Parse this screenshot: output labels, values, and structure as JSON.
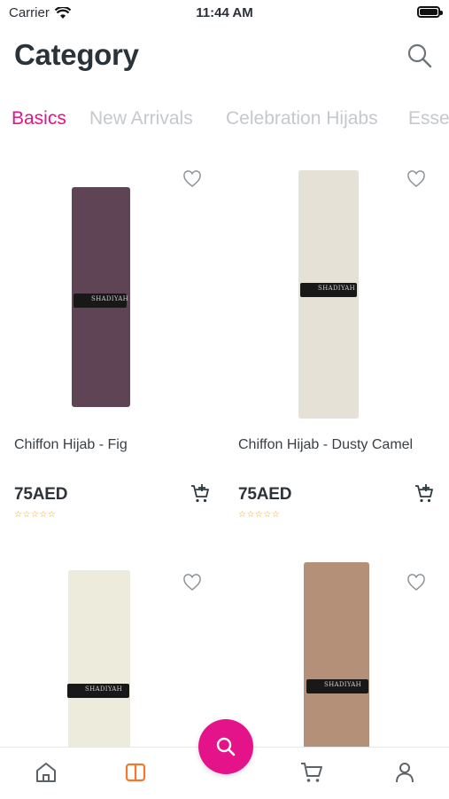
{
  "status_bar": {
    "carrier": "Carrier",
    "time": "11:44 AM"
  },
  "header": {
    "title": "Category",
    "search_icon": "search-icon"
  },
  "tabs": [
    {
      "label": "Basics",
      "active": true
    },
    {
      "label": "New Arrivals",
      "active": false
    },
    {
      "label": "Celebration Hijabs",
      "active": false
    },
    {
      "label": "Esse",
      "active": false
    }
  ],
  "products": [
    {
      "name": "Chiffon Hijab - Fig",
      "price": "75AED",
      "rating_stars": "☆☆☆☆☆",
      "color": "#5e4454",
      "band_text": "SHADIYAH"
    },
    {
      "name": "Chiffon Hijab - Dusty Camel",
      "price": "75AED",
      "rating_stars": "☆☆☆☆☆",
      "color": "#e6e1d6",
      "band_text": "SHADIYAH"
    },
    {
      "name": "",
      "price": "",
      "rating_stars": "",
      "color": "#ecebdc",
      "band_text": "SHADIYAH"
    },
    {
      "name": "",
      "price": "",
      "rating_stars": "",
      "color": "#b49078",
      "band_text": "SHADIYAH"
    }
  ],
  "bottom_nav": {
    "items": [
      "home-icon",
      "catalog-icon",
      "search-fab-icon",
      "cart-icon",
      "profile-icon"
    ],
    "active": "catalog-icon",
    "accent": "#e5138a",
    "active_color": "#f07a2a"
  }
}
